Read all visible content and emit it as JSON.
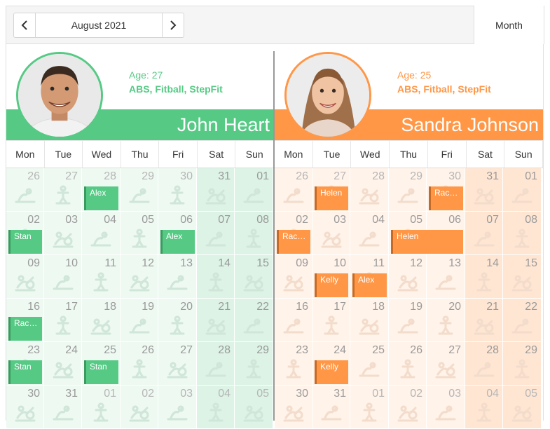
{
  "toolbar": {
    "date_label": "August 2021",
    "view_label": "Month",
    "prev_icon": "chevron-left-icon",
    "next_icon": "chevron-right-icon"
  },
  "days": [
    "Mon",
    "Tue",
    "Wed",
    "Thu",
    "Fri",
    "Sat",
    "Sun"
  ],
  "resources": [
    {
      "name": "John Heart",
      "age": "Age: 27",
      "specialties": "ABS, Fitball, StepFit",
      "color": "#56ca85",
      "cell_bg": "#eef9f2",
      "weekend_bg": "#dcf3e6",
      "num_color": "#9a9a9a",
      "num_color_next": "#b6b6b6",
      "appt_bg": "#56ca85",
      "appt_border": "#3a9a60",
      "appointments": [
        {
          "week": 0,
          "day": 2,
          "span": 1,
          "label": "Alex"
        },
        {
          "week": 1,
          "day": 0,
          "span": 1,
          "label": "Stan"
        },
        {
          "week": 1,
          "day": 4,
          "span": 1,
          "label": "Alex"
        },
        {
          "week": 3,
          "day": 0,
          "span": 1,
          "label": "Rac…"
        },
        {
          "week": 4,
          "day": 0,
          "span": 1,
          "label": "Stan"
        },
        {
          "week": 4,
          "day": 2,
          "span": 1,
          "label": "Stan"
        }
      ]
    },
    {
      "name": "Sandra Johnson",
      "age": "Age: 25",
      "specialties": "ABS, Fitball, StepFit",
      "color": "#ff9747",
      "cell_bg": "#fff3ea",
      "weekend_bg": "#ffe6d3",
      "num_color": "#9a9a9a",
      "num_color_next": "#b6b6b6",
      "appt_bg": "#ff9747",
      "appt_border": "#c66a24",
      "appointments": [
        {
          "week": 0,
          "day": 1,
          "span": 1,
          "label": "Helen"
        },
        {
          "week": 0,
          "day": 4,
          "span": 1,
          "label": "Rac…"
        },
        {
          "week": 1,
          "day": 0,
          "span": 1,
          "label": "Rac…"
        },
        {
          "week": 1,
          "day": 3,
          "span": 2,
          "label": "Helen"
        },
        {
          "week": 2,
          "day": 1,
          "span": 1,
          "label": "Kelly"
        },
        {
          "week": 2,
          "day": 2,
          "span": 1,
          "label": "Alex"
        },
        {
          "week": 4,
          "day": 1,
          "span": 1,
          "label": "Kelly"
        }
      ]
    }
  ],
  "weeks": [
    [
      "26",
      "27",
      "28",
      "29",
      "30",
      "31",
      "01"
    ],
    [
      "02",
      "03",
      "04",
      "05",
      "06",
      "07",
      "08"
    ],
    [
      "09",
      "10",
      "11",
      "12",
      "13",
      "14",
      "15"
    ],
    [
      "16",
      "17",
      "18",
      "19",
      "20",
      "21",
      "22"
    ],
    [
      "23",
      "24",
      "25",
      "26",
      "27",
      "28",
      "29"
    ],
    [
      "30",
      "31",
      "01",
      "02",
      "03",
      "04",
      "05"
    ]
  ],
  "other_month": [
    [
      true,
      true,
      true,
      true,
      true,
      false,
      false
    ],
    [
      false,
      false,
      false,
      false,
      false,
      false,
      false
    ],
    [
      false,
      false,
      false,
      false,
      false,
      false,
      false
    ],
    [
      false,
      false,
      false,
      false,
      false,
      false,
      false
    ],
    [
      false,
      false,
      false,
      false,
      false,
      false,
      false
    ],
    [
      false,
      false,
      true,
      true,
      true,
      true,
      true
    ]
  ]
}
